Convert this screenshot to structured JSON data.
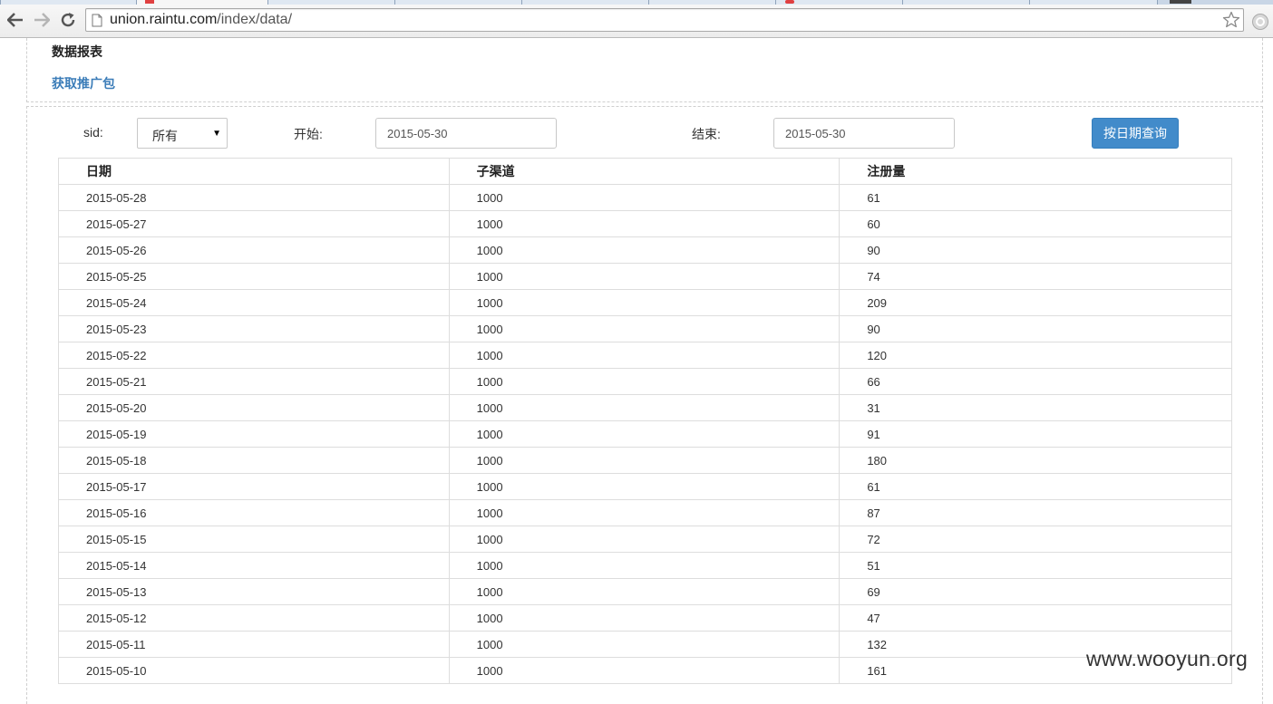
{
  "browser": {
    "url_host": "union.raintu.com",
    "url_path": "/index/data/"
  },
  "page": {
    "title": "数据报表",
    "get_package_link": "获取推广包"
  },
  "filters": {
    "sid_label": "sid:",
    "sid_value": "所有",
    "start_label": "开始:",
    "start_value": "2015-05-30",
    "end_label": "结束:",
    "end_value": "2015-05-30",
    "query_button": "按日期查询"
  },
  "table": {
    "headers": [
      "日期",
      "子渠道",
      "注册量"
    ],
    "rows": [
      [
        "2015-05-28",
        "1000",
        "61"
      ],
      [
        "2015-05-27",
        "1000",
        "60"
      ],
      [
        "2015-05-26",
        "1000",
        "90"
      ],
      [
        "2015-05-25",
        "1000",
        "74"
      ],
      [
        "2015-05-24",
        "1000",
        "209"
      ],
      [
        "2015-05-23",
        "1000",
        "90"
      ],
      [
        "2015-05-22",
        "1000",
        "120"
      ],
      [
        "2015-05-21",
        "1000",
        "66"
      ],
      [
        "2015-05-20",
        "1000",
        "31"
      ],
      [
        "2015-05-19",
        "1000",
        "91"
      ],
      [
        "2015-05-18",
        "1000",
        "180"
      ],
      [
        "2015-05-17",
        "1000",
        "61"
      ],
      [
        "2015-05-16",
        "1000",
        "87"
      ],
      [
        "2015-05-15",
        "1000",
        "72"
      ],
      [
        "2015-05-14",
        "1000",
        "51"
      ],
      [
        "2015-05-13",
        "1000",
        "69"
      ],
      [
        "2015-05-12",
        "1000",
        "47"
      ],
      [
        "2015-05-11",
        "1000",
        "132"
      ],
      [
        "2015-05-10",
        "1000",
        "161"
      ]
    ]
  },
  "watermark": "www.wooyun.org"
}
